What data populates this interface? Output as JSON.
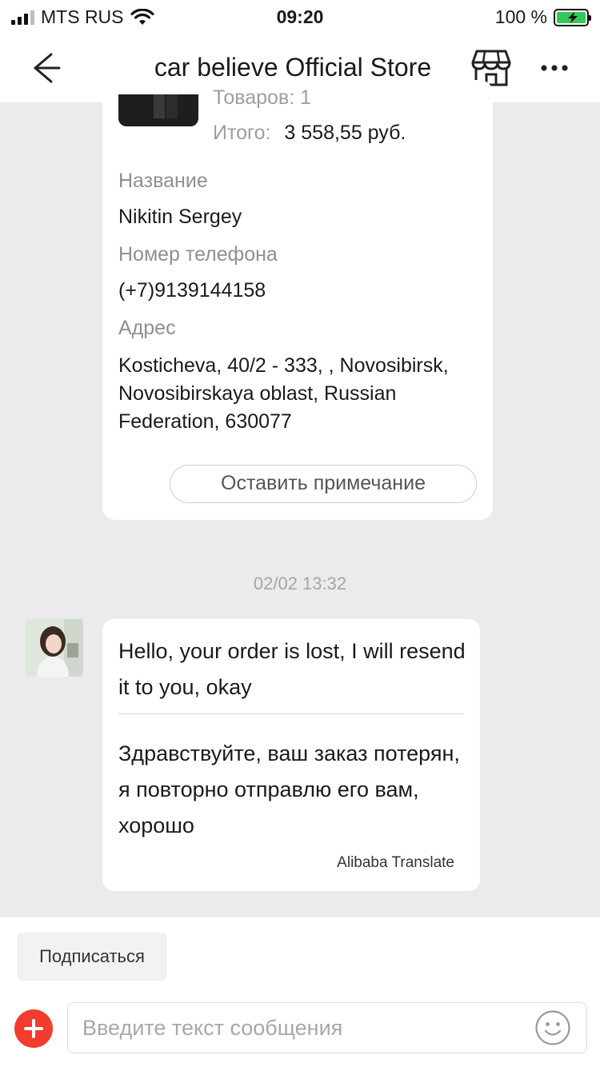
{
  "status_bar": {
    "carrier": "MTS RUS",
    "time": "09:20",
    "battery": "100 %"
  },
  "nav": {
    "title": "car believe Official Store",
    "icons": [
      "back-arrow-icon",
      "store-icon",
      "more-icon"
    ]
  },
  "order_card": {
    "items_count": "Товаров: 1",
    "total_label": "Итого:",
    "total_value": "3 558,55 руб.",
    "name_label": "Название",
    "name_value": "Nikitin Sergey",
    "phone_label": "Номер телефона",
    "phone_value": "(+7)9139144158",
    "address_label": "Адрес",
    "address_value": "Kosticheva, 40/2 - 333, , Novosibirsk, Novosibirskaya oblast, Russian Federation, 630077",
    "note_button": "Оставить примечание"
  },
  "chat": {
    "timestamp": "02/02 13:32",
    "message": {
      "original": "Hello, your order is lost, I will resend it to you, okay",
      "translated": "Здравствуйте, ваш заказ потерян, я повторно отправлю его вам, хорошо",
      "translator": "Alibaba Translate"
    }
  },
  "bottom_bar": {
    "subscribe_label": "Подписаться",
    "input_placeholder": "Введите текст сообщения",
    "accent_color": "#f23c2e"
  },
  "colors": {
    "background": "#ebebeb",
    "card": "#ffffff",
    "muted_text": "#8f8f8f",
    "battery_green": "#34c759"
  }
}
